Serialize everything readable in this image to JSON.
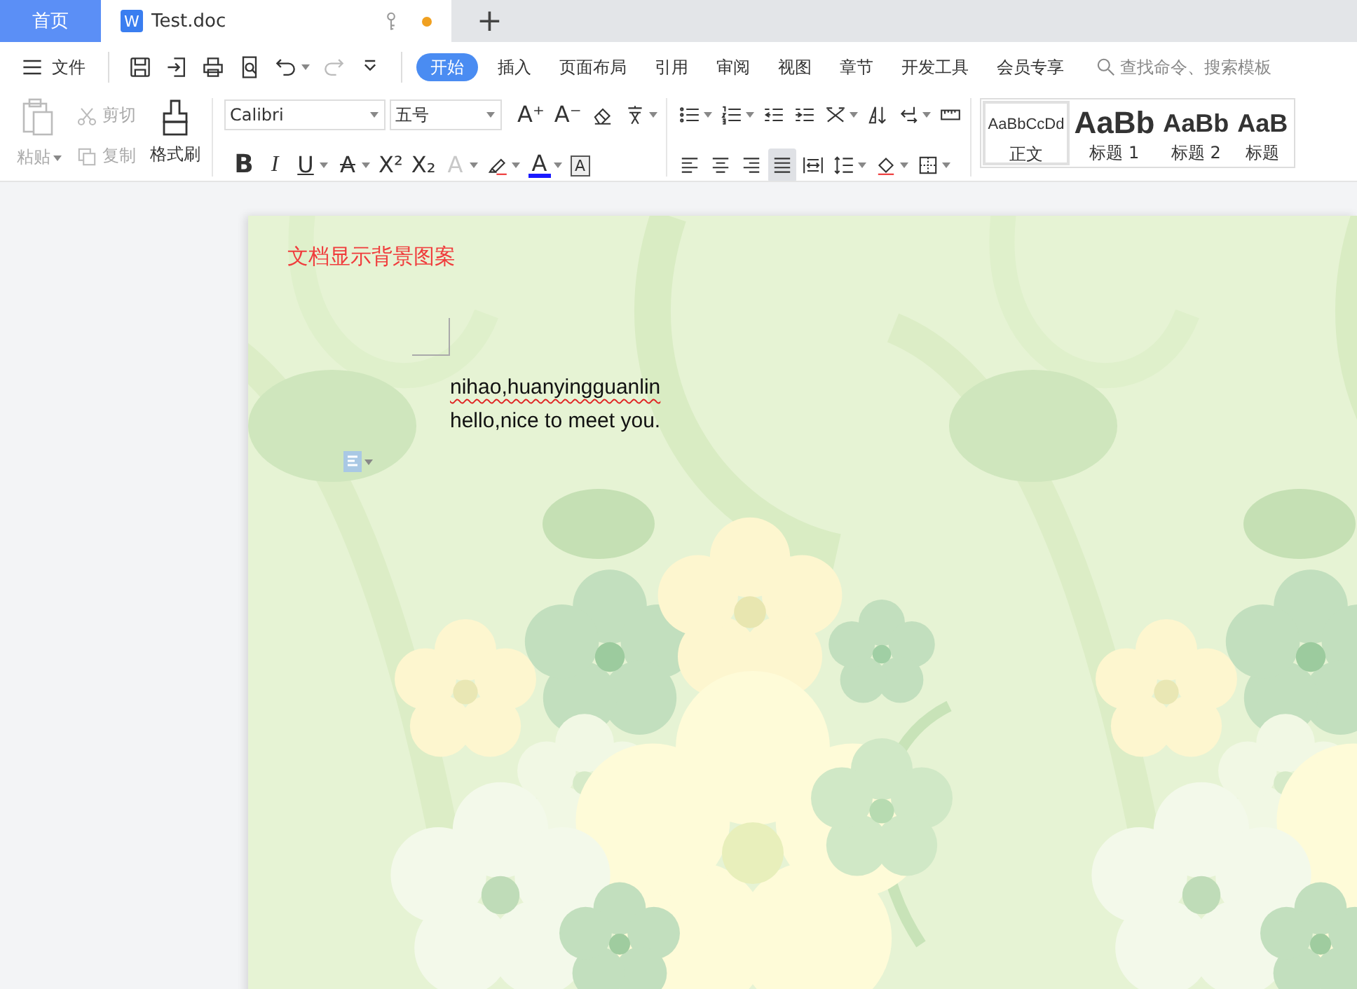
{
  "tabs": [
    {
      "label": "首页",
      "kind": "home",
      "selected": false
    },
    {
      "label": "Test.doc",
      "kind": "document",
      "icon_glyph": "W",
      "selected": true,
      "unsaved": true
    }
  ],
  "new_tab_label": "+",
  "menu": {
    "file_label": "文件",
    "quick_access": [
      {
        "kind": "save",
        "disabled": false,
        "dropdown": false
      },
      {
        "kind": "export",
        "disabled": false,
        "dropdown": false
      },
      {
        "kind": "print",
        "disabled": false,
        "dropdown": false
      },
      {
        "kind": "preview",
        "disabled": false,
        "dropdown": false
      },
      {
        "kind": "undo",
        "disabled": false,
        "dropdown": true
      },
      {
        "kind": "redo",
        "disabled": true,
        "dropdown": false
      },
      {
        "kind": "customize",
        "disabled": false,
        "dropdown": false
      }
    ],
    "ribbon_tabs": [
      {
        "label": "开始",
        "selected": true
      },
      {
        "label": "插入",
        "selected": false
      },
      {
        "label": "页面布局",
        "selected": false
      },
      {
        "label": "引用",
        "selected": false
      },
      {
        "label": "审阅",
        "selected": false
      },
      {
        "label": "视图",
        "selected": false
      },
      {
        "label": "章节",
        "selected": false
      },
      {
        "label": "开发工具",
        "selected": false
      },
      {
        "label": "会员专享",
        "selected": false
      }
    ],
    "search": {
      "placeholder": "查找命令、搜索模板"
    }
  },
  "ribbon": {
    "clipboard": {
      "paste": {
        "label": "粘贴",
        "disabled": true
      },
      "cut": {
        "label": "剪切",
        "disabled": true
      },
      "copy": {
        "label": "复制",
        "disabled": true
      },
      "format_painter": {
        "label": "格式刷",
        "disabled": false
      }
    },
    "font": {
      "name": "Calibri",
      "size": "五号",
      "row_1": [
        {
          "kind": "grow",
          "glyph": "A⁺",
          "dropdown": false
        },
        {
          "kind": "shrink",
          "glyph": "A⁻",
          "dropdown": false
        },
        {
          "kind": "eraser",
          "dropdown": false
        },
        {
          "kind": "pinyin",
          "dropdown": true
        }
      ],
      "row_2": [
        {
          "kind": "bold",
          "glyph": "B",
          "dropdown": false
        },
        {
          "kind": "italic",
          "glyph": "I",
          "dropdown": false
        },
        {
          "kind": "underline",
          "glyph": "U",
          "dropdown": true
        },
        {
          "kind": "strike",
          "glyph": "A",
          "dropdown": true
        },
        {
          "kind": "superscript",
          "glyph": "X²",
          "dropdown": false
        },
        {
          "kind": "subscript",
          "glyph": "X₂",
          "dropdown": false
        },
        {
          "kind": "effects",
          "glyph": "A",
          "dropdown": true
        },
        {
          "kind": "highlighter",
          "dropdown": true
        },
        {
          "kind": "color",
          "glyph": "A",
          "dropdown": true
        },
        {
          "kind": "boxed",
          "glyph": "A",
          "dropdown": false
        }
      ]
    },
    "paragraph": {
      "row_1": [
        {
          "kind": "bullets",
          "dropdown": true
        },
        {
          "kind": "numbering",
          "dropdown": true
        },
        {
          "kind": "outdent",
          "dropdown": false
        },
        {
          "kind": "indent",
          "dropdown": false
        },
        {
          "kind": "cnlayout",
          "dropdown": true
        },
        {
          "kind": "sort",
          "dropdown": false
        },
        {
          "kind": "marks",
          "dropdown": true
        },
        {
          "kind": "ruler",
          "dropdown": false
        }
      ],
      "row_2": [
        {
          "kind": "align_left",
          "selected": false,
          "dropdown": false
        },
        {
          "kind": "align_center",
          "selected": false,
          "dropdown": false
        },
        {
          "kind": "align_right",
          "selected": false,
          "dropdown": false
        },
        {
          "kind": "justify",
          "selected": true,
          "dropdown": false
        },
        {
          "kind": "distribute",
          "selected": false,
          "dropdown": false
        },
        {
          "kind": "linespacing",
          "selected": false,
          "dropdown": true
        },
        {
          "kind": "shading",
          "selected": false,
          "dropdown": true
        },
        {
          "kind": "borders",
          "selected": false,
          "dropdown": true
        }
      ]
    },
    "styles": [
      {
        "kind": "body",
        "sample": "AaBbCcDd",
        "label": "正文",
        "selected": true
      },
      {
        "kind": "heading1",
        "sample": "AaBb",
        "label": "标题 1",
        "selected": false
      },
      {
        "kind": "heading2",
        "sample": "AaBb",
        "label": "标题 2",
        "selected": false
      },
      {
        "kind": "heading3",
        "sample": "AaB",
        "label": "标题",
        "selected": false
      }
    ]
  },
  "document": {
    "header": "文档显示背景图案",
    "lines": [
      {
        "text": "nihao,huanyingguanlin",
        "misspelled": true
      },
      {
        "text": "hello,nice to meet you.",
        "misspelled": false
      }
    ]
  }
}
